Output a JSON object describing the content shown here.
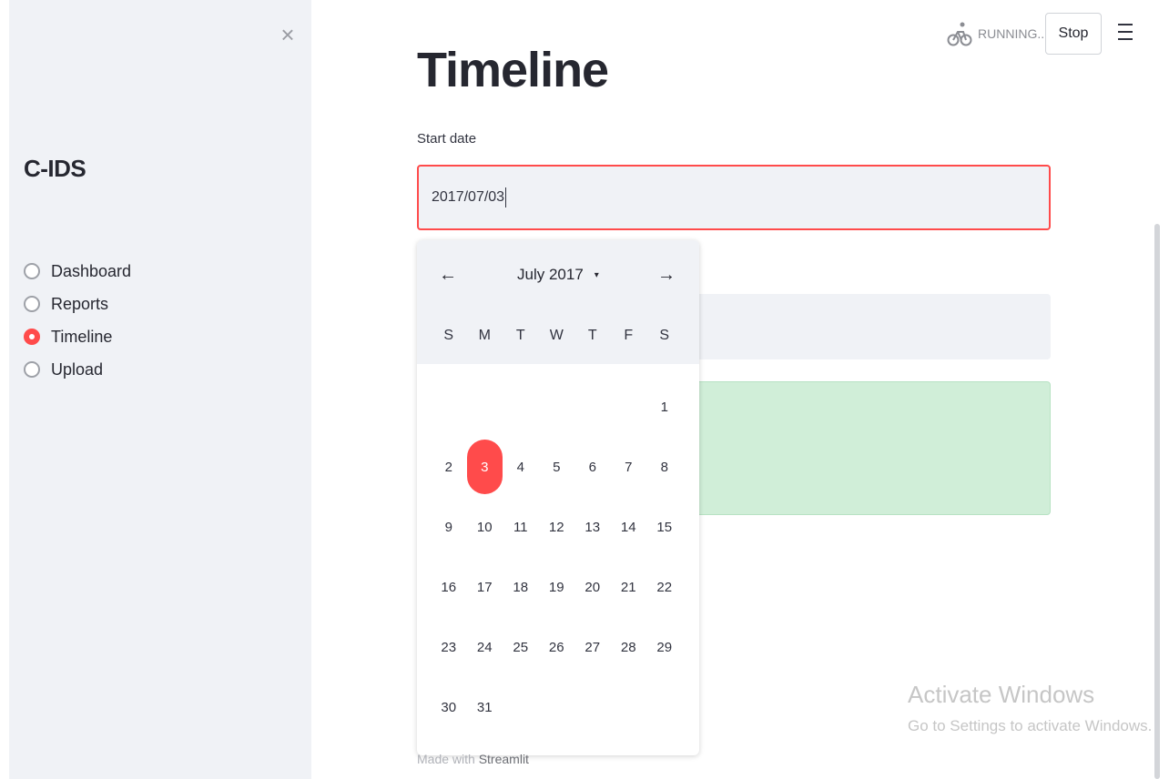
{
  "sidebar": {
    "close_icon": "×",
    "title": "C-IDS",
    "items": [
      {
        "label": "Dashboard",
        "checked": false
      },
      {
        "label": "Reports",
        "checked": false
      },
      {
        "label": "Timeline",
        "checked": true
      },
      {
        "label": "Upload",
        "checked": false
      }
    ]
  },
  "header": {
    "running_text": "RUNNING...",
    "running_icon": "bicycle-icon",
    "stop_label": "Stop",
    "menu_icon": "hamburger-menu-icon"
  },
  "main": {
    "title": "Timeline",
    "start_date_label": "Start date",
    "start_date_value": "2017/07/03"
  },
  "calendar": {
    "month_label": "July 2017",
    "prev_icon": "←",
    "next_icon": "→",
    "dropdown_icon": "▾",
    "weekdays": [
      "S",
      "M",
      "T",
      "W",
      "T",
      "F",
      "S"
    ],
    "days": [
      "",
      "",
      "",
      "",
      "",
      "",
      "1",
      "2",
      "3",
      "4",
      "5",
      "6",
      "7",
      "8",
      "9",
      "10",
      "11",
      "12",
      "13",
      "14",
      "15",
      "16",
      "17",
      "18",
      "19",
      "20",
      "21",
      "22",
      "23",
      "24",
      "25",
      "26",
      "27",
      "28",
      "29",
      "30",
      "31"
    ],
    "selected_day": "3"
  },
  "footer": {
    "made_with_prefix": "Made with ",
    "made_with_brand": "Streamlit"
  },
  "watermark": {
    "title": "Activate Windows",
    "subtitle": "Go to Settings to activate Windows."
  },
  "colors": {
    "accent": "#ff4b4b",
    "sidebar_bg": "#f0f2f6",
    "success_bg": "#d0eed8"
  }
}
